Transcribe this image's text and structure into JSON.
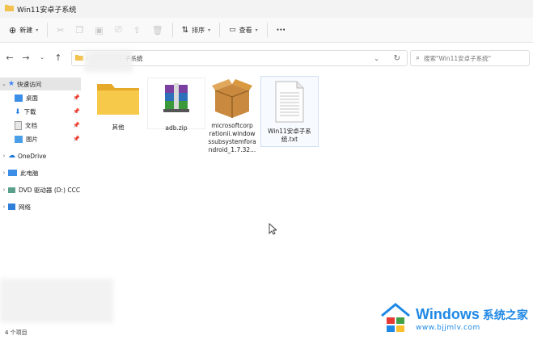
{
  "window": {
    "title": "Win11安卓子系统"
  },
  "toolbar": {
    "new_label": "新建",
    "sort_label": "排序",
    "view_label": "查看",
    "more_label": "···"
  },
  "navigation": {
    "address_path": "子系统",
    "search_placeholder": "搜索\"Win11安卓子系统\""
  },
  "sidebar": {
    "quick_access": "快速访问",
    "items": [
      {
        "label": "桌面"
      },
      {
        "label": "下载"
      },
      {
        "label": "文档"
      },
      {
        "label": "图片"
      }
    ],
    "onedrive": "OneDrive",
    "this_pc": "此电脑",
    "dvd": "DVD 驱动器 (D:) CCC",
    "network": "网络"
  },
  "files": [
    {
      "name": "其他",
      "icon": "folder-icon"
    },
    {
      "name": "adb.zip",
      "icon": "winrar-archive-icon"
    },
    {
      "name": "microsoftcorp\nrationii.window\nssubsystemfora\nndroid_1.7.32...",
      "icon": "package-box-icon"
    },
    {
      "name": "Win11安卓子系\n统.txt",
      "icon": "text-file-icon"
    }
  ],
  "status": {
    "item_count": "4 个项目"
  },
  "watermark": {
    "brand": "Windows",
    "site_name": "系统之家",
    "url": "www.bjjmlv.com",
    "colors": {
      "blue": "#1e88e5",
      "orange": "#f57c00"
    }
  }
}
